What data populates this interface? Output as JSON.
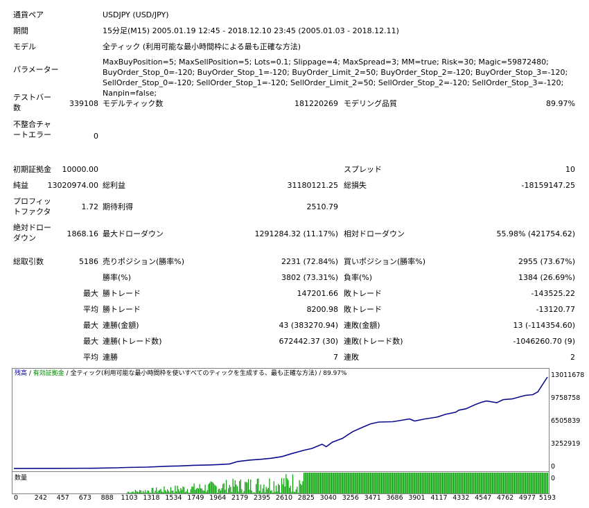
{
  "header": {
    "symbol": {
      "label": "通貨ペア",
      "value": "USDJPY (USD/JPY)"
    },
    "period": {
      "label": "期間",
      "value": "15分足(M15) 2005.01.19 12:45 - 2018.12.10 23:45 (2005.01.03 - 2018.12.11)"
    },
    "model": {
      "label": "モデル",
      "value": "全ティック (利用可能な最小時間枠による最も正確な方法)"
    },
    "parameters": {
      "label": "パラメーター",
      "value": "MaxBuyPosition=5; MaxSellPosition=5; Lots=0.1; Slippage=4; MaxSpread=3; MM=true; Risk=30; Magic=59872480; BuyOrder_Stop_0=-120; BuyOrder_Stop_1=-120; BuyOrder_Limit_2=50; BuyOrder_Stop_2=-120; BuyOrder_Stop_3=-120; SellOrder_Stop_0=-120; SellOrder_Stop_1=-120; SellOrder_Limit_2=50; SellOrder_Stop_2=-120; SellOrder_Stop_3=-120; Nanpin=false;"
    }
  },
  "stats": {
    "bars_label": "テストバー数",
    "bars": "339108",
    "ticks_label": "モデルティック数",
    "ticks": "181220269",
    "quality_label": "モデリング品質",
    "quality": "89.97%",
    "mismatch_label": "不整合チャートエラー",
    "mismatch": "0",
    "deposit_label": "初期証拠金",
    "deposit": "10000.00",
    "spread_label": "スプレッド",
    "spread": "10",
    "net_label": "純益",
    "net": "13020974.00",
    "gross_profit_label": "総利益",
    "gross_profit": "31180121.25",
    "gross_loss_label": "総損失",
    "gross_loss": "-18159147.25",
    "pf_label": "プロフィットファクタ",
    "pf": "1.72",
    "payoff_label": "期待利得",
    "payoff": "2510.79",
    "abs_dd_label": "絶対ドローダウン",
    "abs_dd": "1868.16",
    "max_dd_label": "最大ドローダウン",
    "max_dd": "1291284.32 (11.17%)",
    "rel_dd_label": "相対ドローダウン",
    "rel_dd": "55.98% (421754.62)",
    "trades_label": "総取引数",
    "trades": "5186",
    "short_label": "売りポジション(勝率%)",
    "short": "2231 (72.84%)",
    "long_label": "買いポジション(勝率%)",
    "long": "2955 (73.67%)",
    "win_pct_label": "勝率(%)",
    "win_pct": "3802 (73.31%)",
    "loss_pct_label": "負率(%)",
    "loss_pct": "1384 (26.69%)",
    "max_word": "最大",
    "avg_word": "平均",
    "largest_win_label": "勝トレード",
    "largest_win": "147201.66",
    "largest_loss_label": "敗トレード",
    "largest_loss": "-143525.22",
    "avg_win_label": "勝トレード",
    "avg_win": "8200.98",
    "avg_loss_label": "敗トレード",
    "avg_loss": "-13120.77",
    "cons_wins_label": "連勝(金額)",
    "cons_wins": "43 (383270.94)",
    "cons_losses_label": "連敗(金額)",
    "cons_losses": "13 (-114354.60)",
    "cons_profit_label": "連勝(トレード数)",
    "cons_profit": "672442.37 (30)",
    "cons_loss_label": "連敗(トレード数)",
    "cons_loss": "-1046260.70 (9)",
    "avg_cons_wins_label": "連勝",
    "avg_cons_wins": "7",
    "avg_cons_losses_label": "連敗",
    "avg_cons_losses": "2"
  },
  "chart_legend": {
    "balance": "残高",
    "sep1": " / ",
    "equity": "有効証拠金",
    "sep2": " / ",
    "rest": "全ティック(利用可能な最小時間枠を使いすべてのティックを生成する、最も正確な方法) / 89.97%"
  },
  "vol_label": "数量",
  "colors": {
    "balance": "#0a0a8c",
    "volume": "#00a000",
    "axis": "#808080"
  },
  "chart_data": {
    "type": "line",
    "x_ticks": [
      "0",
      "242",
      "457",
      "673",
      "888",
      "1103",
      "1318",
      "1534",
      "1749",
      "1964",
      "2179",
      "2395",
      "2610",
      "2825",
      "3040",
      "3256",
      "3471",
      "3686",
      "3901",
      "4117",
      "4332",
      "4547",
      "4762",
      "4977",
      "5193"
    ],
    "y_ticks": [
      "13011678",
      "9758758",
      "6505839",
      "3252919",
      "0"
    ],
    "ylim": [
      0,
      13011678
    ],
    "xlim": [
      0,
      5193
    ],
    "series": [
      {
        "values_x": [
          0,
          400,
          800,
          1000,
          1103,
          1300,
          1500,
          1600,
          1749,
          1900,
          2000,
          2100,
          2179,
          2300,
          2395,
          2500,
          2610,
          2700,
          2825,
          2900,
          3000,
          3040,
          3100,
          3200,
          3256,
          3300,
          3400,
          3471,
          3550,
          3686,
          3750,
          3850,
          3901,
          4000,
          4117,
          4200,
          4300,
          4332,
          4400,
          4500,
          4547,
          4600,
          4700,
          4762,
          4850,
          4977,
          5050,
          5100,
          5193
        ],
        "values_y": [
          10000,
          15000,
          40000,
          100000,
          150000,
          200000,
          330000,
          350000,
          450000,
          500000,
          560000,
          650000,
          1000000,
          1200000,
          1300000,
          1450000,
          1700000,
          2100000,
          2600000,
          2850000,
          3450000,
          3100000,
          3750000,
          4300000,
          4850000,
          5250000,
          5900000,
          6350000,
          6600000,
          6650000,
          6800000,
          7050000,
          6750000,
          7050000,
          7300000,
          7700000,
          8000000,
          8300000,
          8500000,
          9150000,
          9400000,
          9600000,
          9350000,
          9800000,
          9900000,
          10400000,
          10500000,
          10900000,
          13011678
        ]
      }
    ]
  }
}
